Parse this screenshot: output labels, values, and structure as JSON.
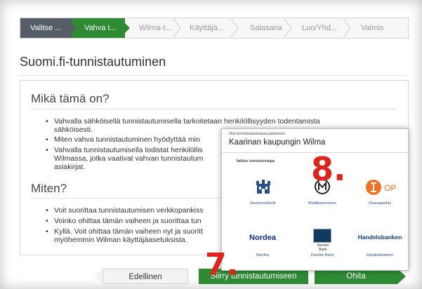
{
  "steps": [
    {
      "label": "Valitse ...",
      "state": "done"
    },
    {
      "label": "Vahva t...",
      "state": "active"
    },
    {
      "label": "Wilma-t...",
      "state": "todo"
    },
    {
      "label": "Käyttäjä...",
      "state": "todo"
    },
    {
      "label": "Salasana",
      "state": "todo"
    },
    {
      "label": "Luo/Yhd...",
      "state": "todo"
    },
    {
      "label": "Valmis",
      "state": "todo"
    }
  ],
  "page": {
    "title": "Suomi.fi-tunnistautuminen"
  },
  "what": {
    "heading": "Mikä tämä on?",
    "items": [
      [
        "Vahvalla sähköisellä tunnistautumisella tarkoitetaan henkilöllisyyden todentamista",
        "sähköisesti."
      ],
      [
        "Miten vahva tunnistautuminen hyödyttää min"
      ],
      [
        "Vahvalla tunnistautumisella todistat henkilöllis",
        "Wilmassa, jotka vaativat vahvan tunnistautum",
        "asiakirjat."
      ]
    ]
  },
  "how": {
    "heading": "Miten?",
    "items": [
      [
        "Voit suorittaa tunnistautumisen verkkopankiss"
      ],
      [
        "Voinko ohittaa tämän vaiheen ja suorittaa tun"
      ],
      [
        "Kyllä. Voit ohittaa tämän vaiheen nyt ja suoritt",
        "myöhemmin Wilman käyttäjäasetuksista."
      ]
    ]
  },
  "buttons": {
    "prev": "Edellinen",
    "go": "Siirry tunnistautumiseen",
    "skip": "Ohita"
  },
  "markers": {
    "m7": "7.",
    "m8": "8."
  },
  "dialog": {
    "small": "Olet tunnistautumassa palveluun",
    "title": "Kaarinan kaupungin Wilma",
    "sub": "Valitse tunnistustapa",
    "providers": [
      {
        "caption": "Varmennekortti",
        "icon": "castle-icon"
      },
      {
        "caption": "Mobiilivarmenne",
        "icon": "mobile-m-icon"
      },
      {
        "caption": "Osuuspankki",
        "icon": "op-logo-icon",
        "logo_text": "OP"
      },
      {
        "caption": "Nordea",
        "icon": "nordea-logo",
        "logo_text": "Nordea"
      },
      {
        "caption": "Danske Bank",
        "icon": "danske-logo-icon",
        "logo_text": "Danske Bank"
      },
      {
        "caption": "Handelsbanken",
        "icon": "handelsbanken-logo",
        "logo_text": "Handelsbanken"
      }
    ]
  },
  "colors": {
    "accent": "#2e8b34",
    "stepDone": "#555d66",
    "marker": "#e1241b"
  }
}
